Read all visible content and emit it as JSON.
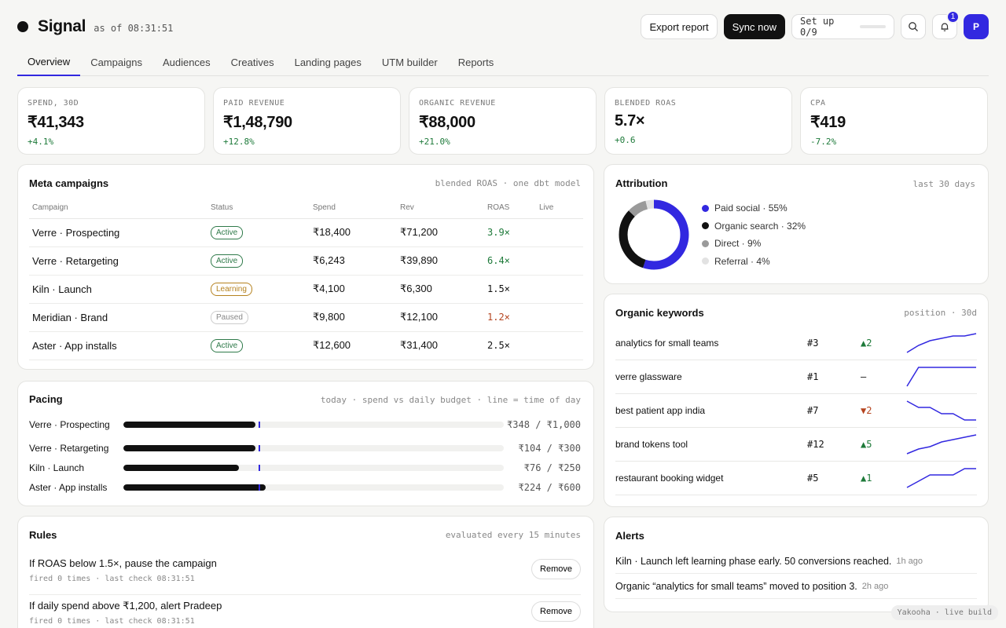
{
  "header": {
    "brand": "Signal",
    "as_of": "as of 08:31:51",
    "export_label": "Export report",
    "sync_label": "Sync now",
    "setup_label": "Set up 0/9",
    "setup_progress": 0,
    "notif_count": "1",
    "avatar_initial": "P",
    "accent": "#3228e0"
  },
  "tabs": [
    "Overview",
    "Campaigns",
    "Audiences",
    "Creatives",
    "Landing pages",
    "UTM builder",
    "Reports"
  ],
  "kpis": [
    {
      "label": "Spend, 30d",
      "value": "₹41,343",
      "delta": "+4.1%"
    },
    {
      "label": "Paid revenue",
      "value": "₹1,48,790",
      "delta": "+12.8%"
    },
    {
      "label": "Organic revenue",
      "value": "₹88,000",
      "delta": "+21.0%"
    },
    {
      "label": "Blended ROAS",
      "value": "5.7×",
      "delta": "+0.6"
    },
    {
      "label": "CPA",
      "value": "₹419",
      "delta": "-7.2%"
    }
  ],
  "campaigns": {
    "title": "Meta campaigns",
    "note": "blended ROAS · one dbt model",
    "columns": [
      "Campaign",
      "Status",
      "Spend",
      "Rev",
      "ROAS",
      "Live"
    ],
    "rows": [
      {
        "name": "Verre · Prospecting",
        "status": "Active",
        "spend": "₹18,400",
        "rev": "₹71,200",
        "roas": "3.9×"
      },
      {
        "name": "Verre · Retargeting",
        "status": "Active",
        "spend": "₹6,243",
        "rev": "₹39,890",
        "roas": "6.4×"
      },
      {
        "name": "Kiln · Launch",
        "status": "Learning",
        "spend": "₹4,100",
        "rev": "₹6,300",
        "roas": "1.5×"
      },
      {
        "name": "Meridian · Brand",
        "status": "Paused",
        "spend": "₹9,800",
        "rev": "₹12,100",
        "roas": "1.2×"
      },
      {
        "name": "Aster · App installs",
        "status": "Active",
        "spend": "₹12,600",
        "rev": "₹31,400",
        "roas": "2.5×"
      }
    ]
  },
  "pacing": {
    "title": "Pacing",
    "note": "today · spend vs daily budget · line = time of day",
    "time_of_day": 0.355,
    "rows": [
      {
        "name": "Verre · Prospecting",
        "value": "₹348 / ₹1,000",
        "spent": 348,
        "budget": 1000
      },
      {
        "name": "Verre · Retargeting",
        "value": "₹104 / ₹300",
        "spent": 104,
        "budget": 300
      },
      {
        "name": "Kiln · Launch",
        "value": "₹76 / ₹250",
        "spent": 76,
        "budget": 250
      },
      {
        "name": "Aster · App installs",
        "value": "₹224 / ₹600",
        "spent": 224,
        "budget": 600
      }
    ]
  },
  "rules": {
    "title": "Rules",
    "note": "evaluated every 15 minutes",
    "remove_label": "Remove",
    "items": [
      {
        "text": "If ROAS below 1.5×, pause the campaign",
        "sub": "fired 0 times · last check 08:31:51"
      },
      {
        "text": "If daily spend above ₹1,200, alert Pradeep",
        "sub": "fired 0 times · last check 08:31:51"
      }
    ]
  },
  "attribution": {
    "title": "Attribution",
    "note": "last 30 days",
    "slices": [
      {
        "label": "Paid social · 55%",
        "value": 55,
        "color": "#3228e0"
      },
      {
        "label": "Organic search · 32%",
        "value": 32,
        "color": "#111111"
      },
      {
        "label": "Direct · 9%",
        "value": 9,
        "color": "#9a9a9a"
      },
      {
        "label": "Referral · 4%",
        "value": 4,
        "color": "#e2e2e2"
      }
    ]
  },
  "keywords": {
    "title": "Organic keywords",
    "note": "position · 30d",
    "rows": [
      {
        "term": "analytics for small teams",
        "pos": "#3",
        "delta": "▲2",
        "dir": "up",
        "trend": [
          9,
          6,
          4,
          3,
          2,
          2,
          1
        ]
      },
      {
        "term": "verre glassware",
        "pos": "#1",
        "delta": "–",
        "dir": "flat",
        "trend": [
          4,
          1,
          1,
          1,
          1,
          1,
          1
        ]
      },
      {
        "term": "best patient app india",
        "pos": "#7",
        "delta": "▼2",
        "dir": "down",
        "trend": [
          5,
          6,
          6,
          7,
          7,
          8,
          8
        ]
      },
      {
        "term": "brand tokens tool",
        "pos": "#12",
        "delta": "▲5",
        "dir": "up",
        "trend": [
          18,
          16,
          15,
          13,
          12,
          11,
          10
        ]
      },
      {
        "term": "restaurant booking widget",
        "pos": "#5",
        "delta": "▲1",
        "dir": "up",
        "trend": [
          9,
          8,
          7,
          7,
          7,
          6,
          6
        ]
      }
    ]
  },
  "alerts": {
    "title": "Alerts",
    "items": [
      {
        "text": "Kiln · Launch left learning phase early. 50 conversions reached.",
        "ago": "1h ago"
      },
      {
        "text": "Organic “analytics for small teams” moved to position 3.",
        "ago": "2h ago"
      }
    ]
  },
  "footer": "Yakooha · live build"
}
